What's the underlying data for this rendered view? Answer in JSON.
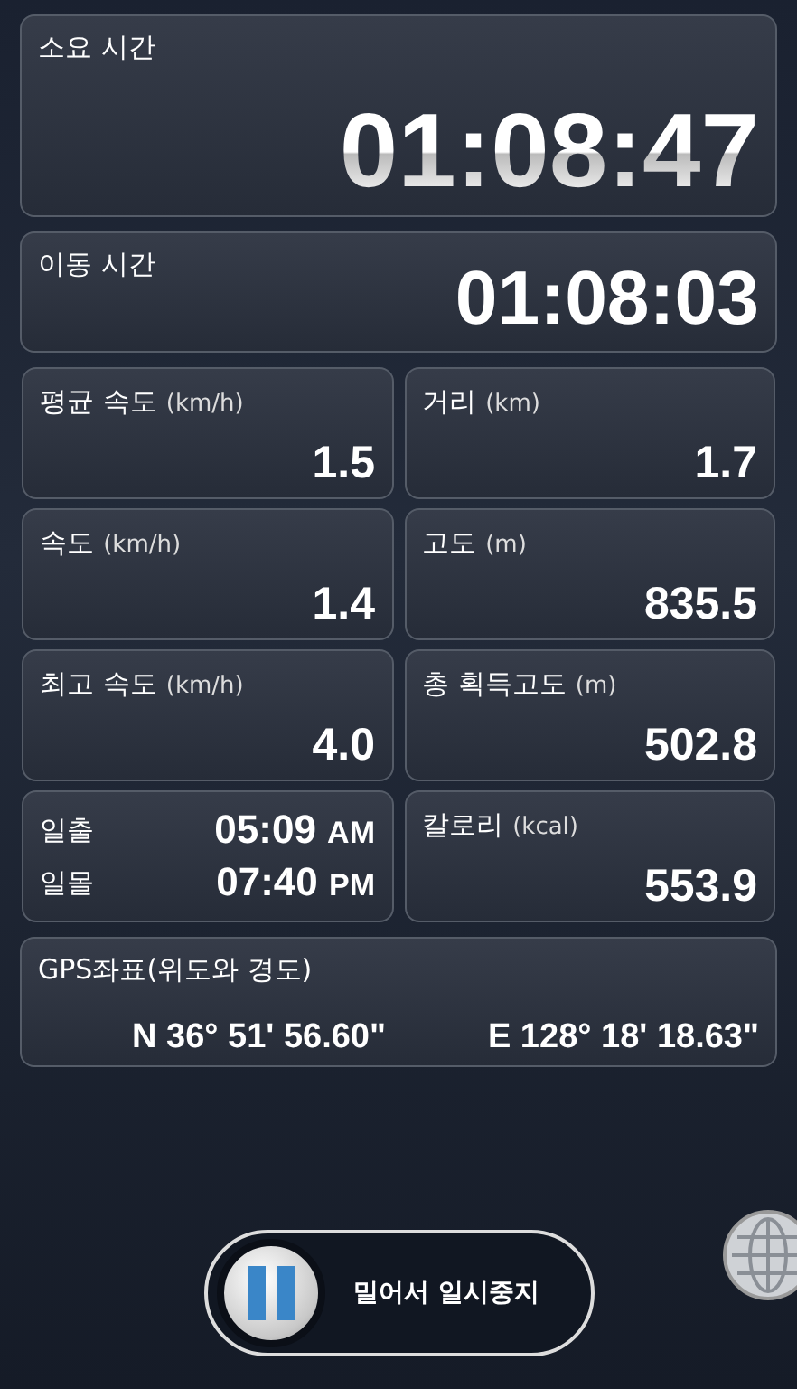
{
  "elapsed_time": {
    "label": "소요 시간",
    "value": "01:08:47"
  },
  "moving_time": {
    "label": "이동 시간",
    "value": "01:08:03"
  },
  "tiles": [
    {
      "kind": "metric",
      "label": "평균 속도",
      "unit": "(km/h)",
      "value": "1.5"
    },
    {
      "kind": "metric",
      "label": "거리",
      "unit": "(km)",
      "value": "1.7"
    },
    {
      "kind": "metric",
      "label": "속도",
      "unit": "(km/h)",
      "value": "1.4"
    },
    {
      "kind": "metric",
      "label": "고도",
      "unit": "(m)",
      "value": "835.5"
    },
    {
      "kind": "metric",
      "label": "최고 속도",
      "unit": "(km/h)",
      "value": "4.0"
    },
    {
      "kind": "metric",
      "label": "총 획득고도",
      "unit": "(m)",
      "value": "502.8"
    },
    {
      "kind": "sun",
      "rows": [
        {
          "label": "일출",
          "time": "05:09",
          "period": "AM"
        },
        {
          "label": "일몰",
          "time": "07:40",
          "period": "PM"
        }
      ]
    },
    {
      "kind": "metric",
      "label": "칼로리",
      "unit": "(kcal)",
      "value": "553.9"
    }
  ],
  "gps": {
    "label": "GPS좌표(위도와 경도)",
    "latitude": "N 36° 51' 56.60\"",
    "longitude": "E 128° 18' 18.63\""
  },
  "pause_slider": {
    "label": "밀어서 일시중지",
    "level": 0
  }
}
